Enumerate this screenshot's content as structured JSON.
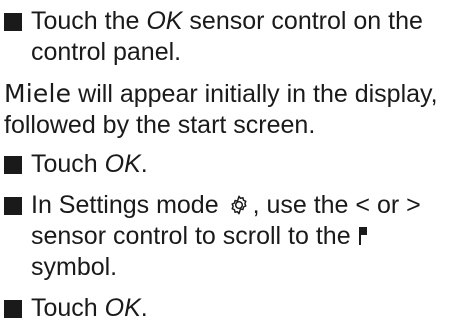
{
  "steps": [
    {
      "pre": "Touch the ",
      "em": "OK",
      "post": " sensor control on the control panel."
    },
    {
      "pre": "Touch ",
      "em": "OK",
      "post": "."
    },
    {
      "part1": "In Settings mode ",
      "gear_icon": "gear-icon",
      "part2": ", use the < or > sensor control to scroll to the ",
      "lock_icon": "lock-symbol",
      "part3": " symbol."
    },
    {
      "pre": "Touch ",
      "em": "OK",
      "post": "."
    }
  ],
  "note": {
    "brand": "Miele",
    "rest": " will appear initially in the display, followed by the start screen."
  }
}
